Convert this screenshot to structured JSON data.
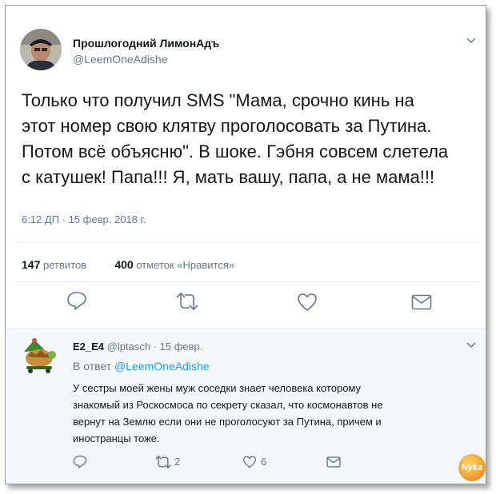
{
  "tweet": {
    "display_name": "Прошлогодний ЛимонАдъ",
    "handle": "@LeemOneAdishe",
    "text": "Только что получил SMS \"Мама, срочно кинь на\nэтот номер свою клятву проголосовать за Путина.\nПотом всё объясню\". В шоке. Гэбня совсем слетела\nс катушек! Папа!!! Я, мать вашу, папа, а не мама!!!",
    "timestamp": "6:12 ДП · 15 февр. 2018 г.",
    "retweets_count": "147",
    "retweets_label": "ретвитов",
    "likes_count": "400",
    "likes_label": "отметок «Нравится»"
  },
  "reply": {
    "display_name": "E2_E4",
    "handle": "@lptasch",
    "date": "· 15 февр.",
    "in_reply_prefix": "В ответ",
    "in_reply_handle": "@LeemOneAdishe",
    "text": "У сестры моей жены муж соседки знает человека которому\nзнакомый из Роскосмоса по секрету сказал, что космонавтов не\nвернут на Землю если они не проголосуют за Путина, причем и\nиностранцы тоже.",
    "retweets_count": "2",
    "likes_count": "6"
  },
  "watermark": "Nyka",
  "colors": {
    "link": "#1da1f2",
    "secondary": "#657786",
    "icon": "#657786",
    "reply_bg": "#f5f8fa"
  },
  "icons": [
    "chevron-down-icon",
    "reply-icon",
    "retweet-icon",
    "like-icon",
    "message-icon"
  ]
}
